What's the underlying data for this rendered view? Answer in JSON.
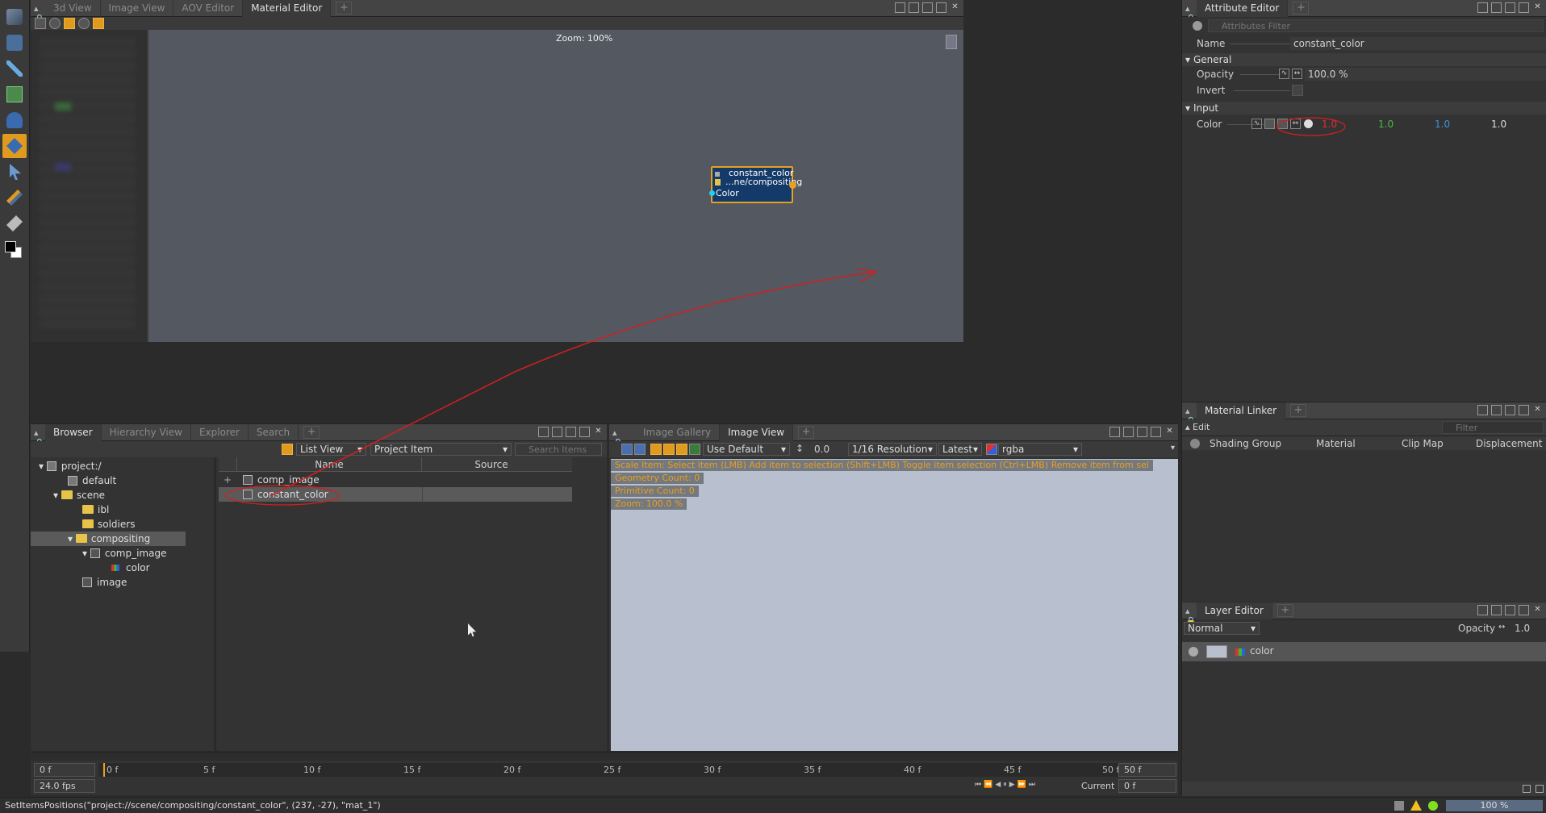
{
  "left_toolbar": {
    "tools": [
      "paint-brush-icon",
      "move-tool-icon",
      "eyedropper-icon",
      "image-layer-icon",
      "bucket-icon",
      "transform-tool-icon",
      "select-arrow-icon",
      "brush-tool-icon",
      "eraser-icon",
      "color-swatch-icon"
    ]
  },
  "top_panel": {
    "tabs": [
      "3d View",
      "Image View",
      "AOV Editor",
      "Material Editor"
    ],
    "active_tab": "Material Editor",
    "zoom_label": "Zoom: 100%",
    "node": {
      "title": "constant_color",
      "path": "...ne/compositing",
      "input": "Color"
    }
  },
  "browser_panel": {
    "tabs": [
      "Browser",
      "Hierarchy View",
      "Explorer",
      "Search"
    ],
    "active_tab": "Browser",
    "view_mode": "List View",
    "item_type": "Project Item",
    "search_placeholder": "Search Items",
    "tree": [
      {
        "label": "project:/",
        "depth": 0,
        "icon": "project"
      },
      {
        "label": "default",
        "depth": 1,
        "icon": "project"
      },
      {
        "label": "scene",
        "depth": 1,
        "icon": "folder"
      },
      {
        "label": "ibl",
        "depth": 2,
        "icon": "folder"
      },
      {
        "label": "soldiers",
        "depth": 2,
        "icon": "folder"
      },
      {
        "label": "compositing",
        "depth": 2,
        "icon": "folder",
        "selected": true
      },
      {
        "label": "comp_image",
        "depth": 3,
        "icon": "node"
      },
      {
        "label": "color",
        "depth": 4,
        "icon": "color"
      },
      {
        "label": "image",
        "depth": 2,
        "icon": "node"
      }
    ],
    "list_headers": {
      "name": "Name",
      "source": "Source"
    },
    "list_rows": [
      {
        "name": "comp_image",
        "source": ""
      },
      {
        "name": "constant_color",
        "source": ""
      }
    ]
  },
  "image_panel": {
    "tabs": [
      "Image Gallery",
      "Image View"
    ],
    "active_tab": "Image View",
    "lut": "Use Default",
    "exposure": "0.0",
    "resolution": "1/16 Resolution",
    "version": "Latest",
    "channels": "rgba",
    "overlay_help": "Scale Item: Select item (LMB)   Add item to selection (Shift+LMB)   Toggle item selection (Ctrl+LMB)   Remove item from sel",
    "geometry_count": "Geometry Count: 0",
    "primitive_count": "Primitive Count: 0",
    "zoom": "Zoom: 100.0 %"
  },
  "timeline": {
    "start": "0 f",
    "end": "50 f",
    "fps": "24.0 fps",
    "current_label": "Current",
    "current_value": "0 f",
    "ticks": [
      "0 f",
      "5 f",
      "10 f",
      "15 f",
      "20 f",
      "25 f",
      "30 f",
      "35 f",
      "40 f",
      "45 f",
      "50 f"
    ]
  },
  "attribute_editor": {
    "tab": "Attribute Editor",
    "filter_placeholder": "Attributes Filter",
    "name_label": "Name",
    "name_value": "constant_color",
    "general_section": "General",
    "opacity_label": "Opacity",
    "opacity_value": "100.0 %",
    "invert_label": "Invert",
    "input_section": "Input",
    "color_label": "Color",
    "color_r": "1.0",
    "color_g": "1.0",
    "color_b": "1.0",
    "color_a": "1.0",
    "colors": {
      "r": "#e03030",
      "g": "#40c040",
      "b": "#4090e0"
    }
  },
  "material_linker": {
    "tab": "Material Linker",
    "edit_label": "Edit",
    "filter_placeholder": "Filter",
    "columns": [
      "Shading Group",
      "Material",
      "Clip Map",
      "Displacement"
    ]
  },
  "layer_editor": {
    "tab": "Layer Editor",
    "blend_mode": "Normal",
    "opacity_label": "Opacity",
    "opacity_value": "1.0",
    "layers": [
      {
        "name": "color"
      }
    ]
  },
  "status_bar": {
    "command": "SetItemsPositions(\"project://scene/compositing/constant_color\", (237, -27), \"mat_1\")",
    "zoom": "100 %"
  }
}
